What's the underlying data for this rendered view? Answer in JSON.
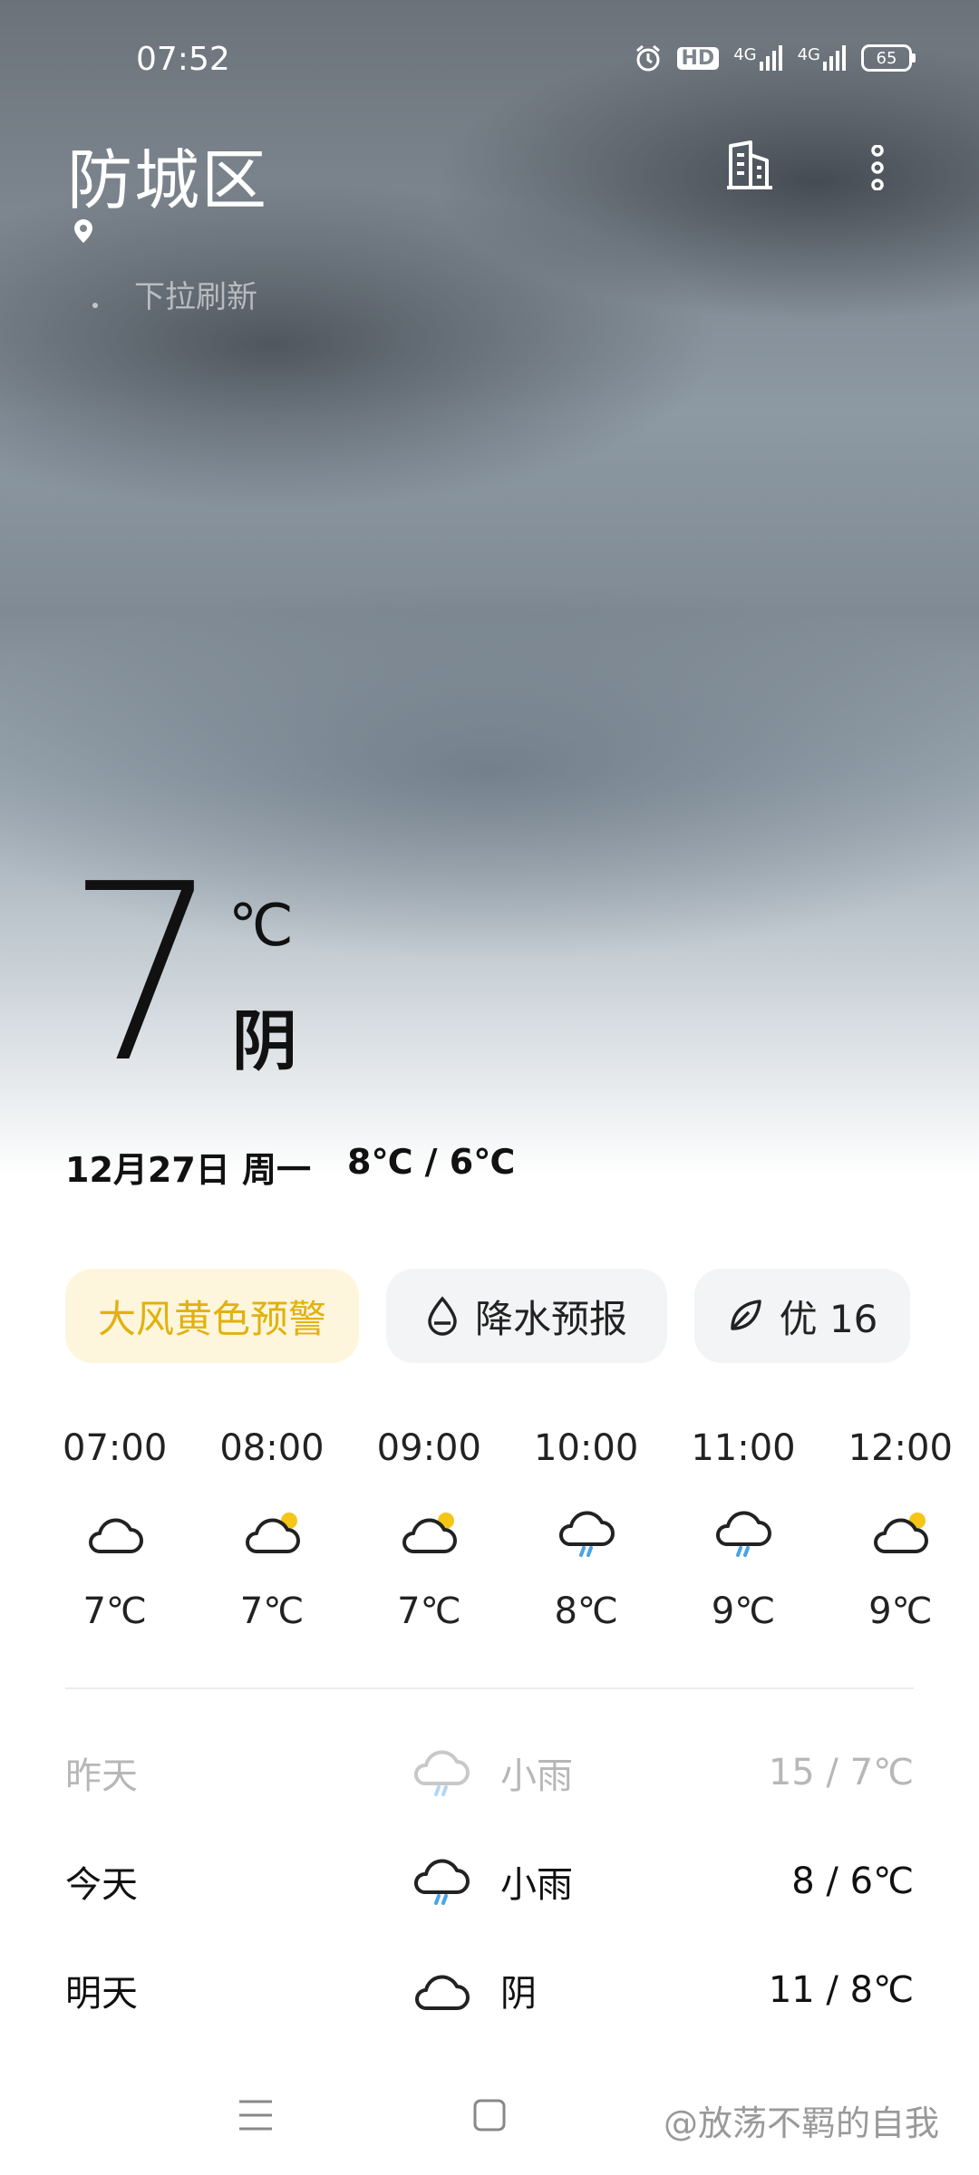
{
  "status": {
    "time": "07:52",
    "hd_badge": "HD",
    "network_1": "4G",
    "network_2": "4G",
    "battery": "65"
  },
  "header": {
    "city": "防城区",
    "refresh_hint": "下拉刷新"
  },
  "current": {
    "temp": "7",
    "unit": "℃",
    "condition": "阴",
    "date": "12月27日 周一",
    "range": "8℃ / 6℃"
  },
  "chips": {
    "alert": "大风黄色预警",
    "precip": "降水预报",
    "aqi": "优 16"
  },
  "hourly": [
    {
      "time": "07:00",
      "icon": "cloudy-icon",
      "temp": "7℃"
    },
    {
      "time": "08:00",
      "icon": "partly-cloudy-icon",
      "temp": "7℃"
    },
    {
      "time": "09:00",
      "icon": "partly-cloudy-icon",
      "temp": "7℃"
    },
    {
      "time": "10:00",
      "icon": "light-rain-icon",
      "temp": "8℃"
    },
    {
      "time": "11:00",
      "icon": "light-rain-icon",
      "temp": "9℃"
    },
    {
      "time": "12:00",
      "icon": "partly-cloudy-icon",
      "temp": "9℃"
    }
  ],
  "daily": [
    {
      "day": "昨天",
      "icon": "light-rain-icon",
      "condition": "小雨",
      "range": "15 / 7℃"
    },
    {
      "day": "今天",
      "icon": "light-rain-icon",
      "condition": "小雨",
      "range": "8 / 6℃"
    },
    {
      "day": "明天",
      "icon": "cloudy-icon",
      "condition": "阴",
      "range": "11 / 8℃"
    }
  ],
  "watermark": "@放荡不羁的自我",
  "colors": {
    "alert_text": "#e2b10c",
    "alert_bg": "#fdf6dd",
    "rain_drop": "#4aa3e8",
    "sun": "#f5c518"
  }
}
